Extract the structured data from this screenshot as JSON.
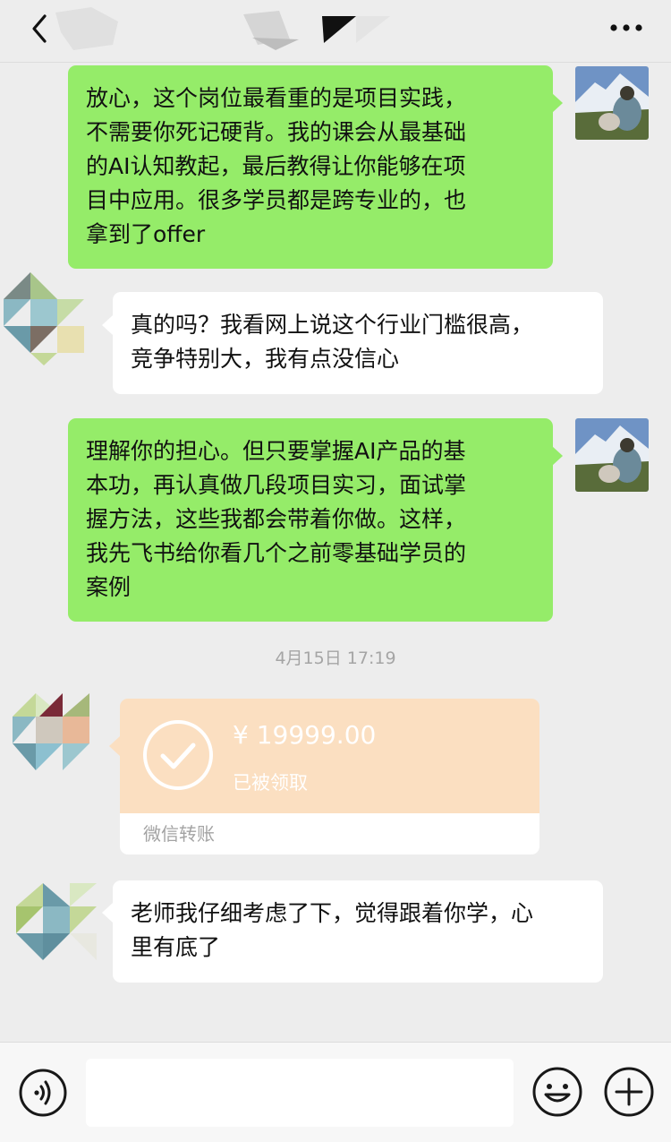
{
  "header": {
    "back_icon": "chevron-left-icon",
    "more_icon": "ellipsis-icon"
  },
  "messages": [
    {
      "side": "right",
      "text": "放心，这个岗位最看重的是项目实践，\n不需要你死记硬背。我的课会从最基础\n的AI认知教起，最后教得让你能够在项\n目中应用。很多学员都是跨专业的，也\n拿到了offer"
    },
    {
      "side": "left",
      "text": "真的吗？我看网上说这个行业门槛很高，\n竞争特别大，我有点没信心"
    },
    {
      "side": "right",
      "text": "理解你的担心。但只要掌握AI产品的基\n本功，再认真做几段项目实习，面试掌\n握方法，这些我都会带着你做。这样，\n我先飞书给你看几个之前零基础学员的\n案例"
    },
    {
      "side": "left",
      "text": "老师我仔细考虑了下，觉得跟着你学，心\n里有底了"
    }
  ],
  "timestamp": "4月15日 17:19",
  "transfer": {
    "amount": "¥ 19999.00",
    "status": "已被领取",
    "label": "微信转账",
    "icon": "check-circle-icon",
    "color": "#fbdfc1"
  },
  "input_bar": {
    "placeholder": "",
    "voice_icon": "voice-icon",
    "emoji_icon": "emoji-icon",
    "plus_icon": "plus-icon"
  },
  "colors": {
    "background": "#ededed",
    "my_bubble": "#95ec69",
    "their_bubble": "#ffffff"
  }
}
